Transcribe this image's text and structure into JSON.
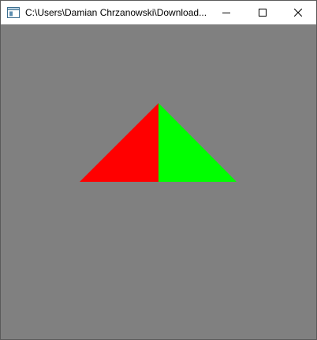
{
  "window": {
    "title": "C:\\Users\\Damian Chrzanowski\\Download...",
    "buttons": {
      "minimize_icon": "minimize-icon",
      "maximize_icon": "maximize-icon",
      "close_icon": "close-icon"
    }
  },
  "scene": {
    "background_color": "#808080",
    "triangles": [
      {
        "name": "left-half",
        "color": "#ff0000"
      },
      {
        "name": "right-half",
        "color": "#00ff00"
      }
    ]
  }
}
